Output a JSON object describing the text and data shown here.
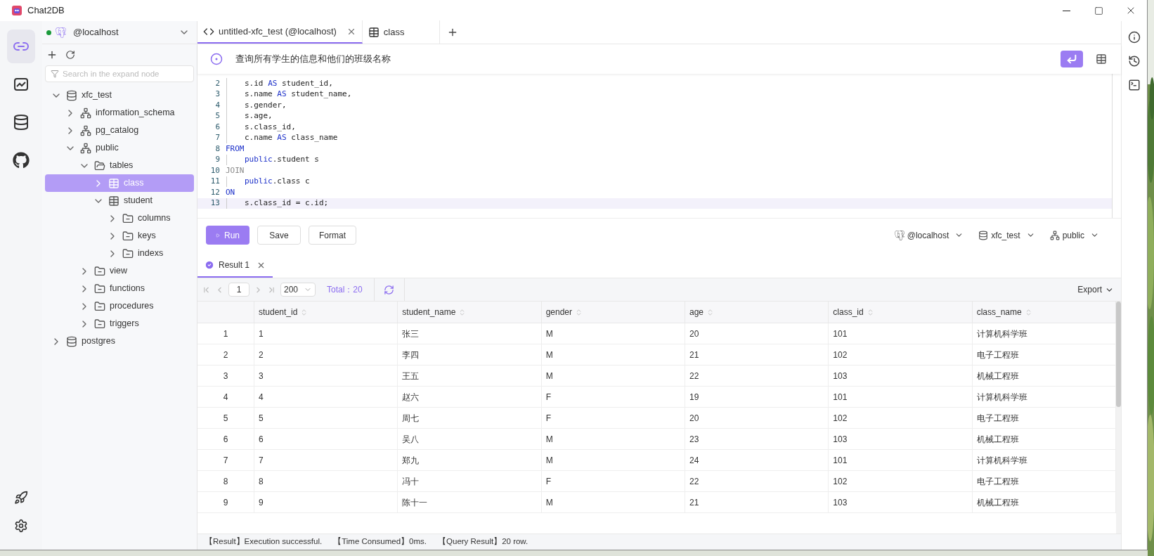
{
  "window": {
    "title": "Chat2DB"
  },
  "nav": {
    "top": [
      {
        "kind": "connections",
        "selected": true
      },
      {
        "kind": "dashboard",
        "selected": false
      },
      {
        "kind": "data",
        "selected": false
      },
      {
        "kind": "github",
        "selected": false
      }
    ],
    "bottom": [
      {
        "kind": "rocket"
      },
      {
        "kind": "settings"
      }
    ]
  },
  "sidebar": {
    "connection": {
      "name": "@localhost",
      "online": true
    },
    "search": {
      "placeholder": "Search in the expand node"
    },
    "tree": [
      {
        "label": "xfc_test",
        "kind": "database",
        "expanded": true,
        "selected": false,
        "children": [
          {
            "label": "information_schema",
            "kind": "schema",
            "expanded": false,
            "selected": false
          },
          {
            "label": "pg_catalog",
            "kind": "schema",
            "expanded": false,
            "selected": false
          },
          {
            "label": "public",
            "kind": "schema",
            "expanded": true,
            "selected": false,
            "children": [
              {
                "label": "tables",
                "kind": "folder-open",
                "expanded": true,
                "selected": false,
                "children": [
                  {
                    "label": "class",
                    "kind": "table",
                    "expanded": false,
                    "selected": true
                  },
                  {
                    "label": "student",
                    "kind": "table",
                    "expanded": true,
                    "selected": false,
                    "children": [
                      {
                        "label": "columns",
                        "kind": "folder",
                        "expanded": false,
                        "selected": false
                      },
                      {
                        "label": "keys",
                        "kind": "folder",
                        "expanded": false,
                        "selected": false
                      },
                      {
                        "label": "indexs",
                        "kind": "folder",
                        "expanded": false,
                        "selected": false
                      }
                    ]
                  }
                ]
              },
              {
                "label": "view",
                "kind": "folder",
                "expanded": false,
                "selected": false
              },
              {
                "label": "functions",
                "kind": "folder",
                "expanded": false,
                "selected": false
              },
              {
                "label": "procedures",
                "kind": "folder",
                "expanded": false,
                "selected": false
              },
              {
                "label": "triggers",
                "kind": "folder",
                "expanded": false,
                "selected": false
              }
            ]
          }
        ]
      },
      {
        "label": "postgres",
        "kind": "database",
        "expanded": false,
        "selected": false
      }
    ]
  },
  "tabs": [
    {
      "label": "untitled-xfc_test (@localhost)",
      "kind": "code",
      "selected": true,
      "closable": true
    },
    {
      "label": "class",
      "kind": "table",
      "selected": false,
      "closable": false
    }
  ],
  "prompt": {
    "text": "查询所有学生的信息和他们的班级名称"
  },
  "editor": {
    "lines": [
      {
        "number": "2",
        "indented": true,
        "current": false,
        "tokens": [
          {
            "text": "s.id ",
            "kind": "plain"
          },
          {
            "text": "AS",
            "kind": "keyword"
          },
          {
            "text": " student_id,",
            "kind": "plain"
          }
        ]
      },
      {
        "number": "3",
        "indented": true,
        "current": false,
        "tokens": [
          {
            "text": "s.name ",
            "kind": "plain"
          },
          {
            "text": "AS",
            "kind": "keyword"
          },
          {
            "text": " student_name,",
            "kind": "plain"
          }
        ]
      },
      {
        "number": "4",
        "indented": true,
        "current": false,
        "tokens": [
          {
            "text": "s.gender,",
            "kind": "plain"
          }
        ]
      },
      {
        "number": "5",
        "indented": true,
        "current": false,
        "tokens": [
          {
            "text": "s.age,",
            "kind": "plain"
          }
        ]
      },
      {
        "number": "6",
        "indented": true,
        "current": false,
        "tokens": [
          {
            "text": "s.class_id,",
            "kind": "plain"
          }
        ]
      },
      {
        "number": "7",
        "indented": true,
        "current": false,
        "tokens": [
          {
            "text": "c.name ",
            "kind": "plain"
          },
          {
            "text": "AS",
            "kind": "keyword"
          },
          {
            "text": " class_name",
            "kind": "plain"
          }
        ]
      },
      {
        "number": "8",
        "indented": false,
        "current": false,
        "tokens": [
          {
            "text": "FROM",
            "kind": "keyword"
          }
        ]
      },
      {
        "number": "9",
        "indented": true,
        "current": false,
        "tokens": [
          {
            "text": "public",
            "kind": "keyword"
          },
          {
            "text": ".student s",
            "kind": "plain"
          }
        ]
      },
      {
        "number": "10",
        "indented": false,
        "current": false,
        "tokens": [
          {
            "text": "JOIN",
            "kind": "muted"
          }
        ]
      },
      {
        "number": "11",
        "indented": true,
        "current": false,
        "tokens": [
          {
            "text": "public",
            "kind": "keyword"
          },
          {
            "text": ".class c",
            "kind": "plain"
          }
        ]
      },
      {
        "number": "12",
        "indented": false,
        "current": false,
        "tokens": [
          {
            "text": "ON",
            "kind": "keyword"
          }
        ]
      },
      {
        "number": "13",
        "indented": true,
        "current": true,
        "tokens": [
          {
            "text": "s.class_id = c.id;",
            "kind": "plain"
          }
        ]
      }
    ]
  },
  "toolbar": {
    "buttons": [
      {
        "label": "Run",
        "primary": true
      },
      {
        "label": "Save",
        "primary": false
      },
      {
        "label": "Format",
        "primary": false
      }
    ],
    "selectors": [
      {
        "label": "@localhost",
        "kind": "postgres"
      },
      {
        "label": "xfc_test",
        "kind": "database"
      },
      {
        "label": "public",
        "kind": "schema"
      }
    ]
  },
  "result_tabs": [
    {
      "label": "Result 1",
      "selected": true,
      "success": true
    }
  ],
  "pagination": {
    "page": "1",
    "page_size": "200",
    "total": "Total：20",
    "export": "Export"
  },
  "table": {
    "columns": [
      "student_id",
      "student_name",
      "gender",
      "age",
      "class_id",
      "class_name"
    ],
    "rows": [
      {
        "number": "1",
        "cells": [
          "1",
          "张三",
          "M",
          "20",
          "101",
          "计算机科学班"
        ]
      },
      {
        "number": "2",
        "cells": [
          "2",
          "李四",
          "M",
          "21",
          "102",
          "电子工程班"
        ]
      },
      {
        "number": "3",
        "cells": [
          "3",
          "王五",
          "M",
          "22",
          "103",
          "机械工程班"
        ]
      },
      {
        "number": "4",
        "cells": [
          "4",
          "赵六",
          "F",
          "19",
          "101",
          "计算机科学班"
        ]
      },
      {
        "number": "5",
        "cells": [
          "5",
          "周七",
          "F",
          "20",
          "102",
          "电子工程班"
        ]
      },
      {
        "number": "6",
        "cells": [
          "6",
          "吴八",
          "M",
          "23",
          "103",
          "机械工程班"
        ]
      },
      {
        "number": "7",
        "cells": [
          "7",
          "郑九",
          "M",
          "24",
          "101",
          "计算机科学班"
        ]
      },
      {
        "number": "8",
        "cells": [
          "8",
          "冯十",
          "F",
          "22",
          "102",
          "电子工程班"
        ]
      },
      {
        "number": "9",
        "cells": [
          "9",
          "陈十一",
          "M",
          "21",
          "103",
          "机械工程班"
        ]
      }
    ]
  },
  "status_bar": [
    "【Result】Execution successful.",
    "【Time Consumed】0ms.",
    "【Query Result】20 row."
  ]
}
